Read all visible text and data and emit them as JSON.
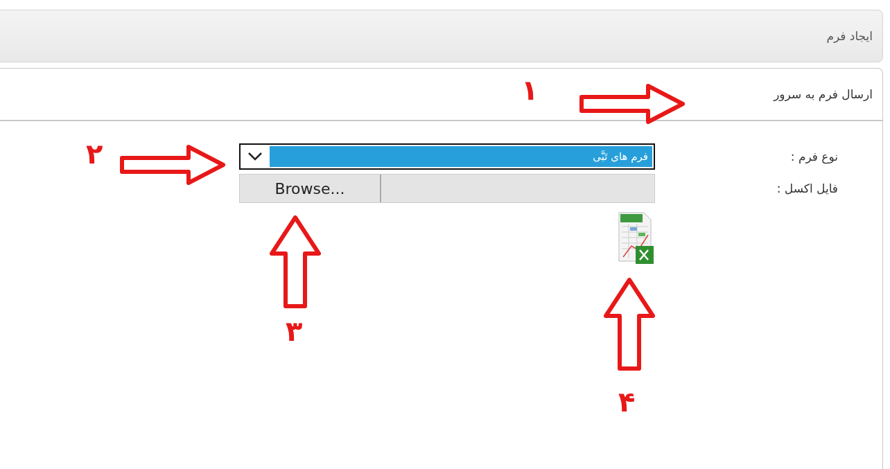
{
  "header": {
    "title": "ایجاد فرم"
  },
  "panel": {
    "title": "ارسال فرم به سرور"
  },
  "form": {
    "fields": [
      {
        "kind": "select",
        "label": "نوع فرم :",
        "value": "فرم های تَبَّی"
      },
      {
        "kind": "file",
        "label": "فایل اکسل :",
        "button": "Browse..."
      }
    ]
  },
  "annotations": [
    {
      "number": "۱",
      "kind": "right"
    },
    {
      "number": "۲",
      "kind": "right"
    },
    {
      "number": "۳",
      "kind": "up"
    },
    {
      "number": "۴",
      "kind": "up"
    }
  ]
}
